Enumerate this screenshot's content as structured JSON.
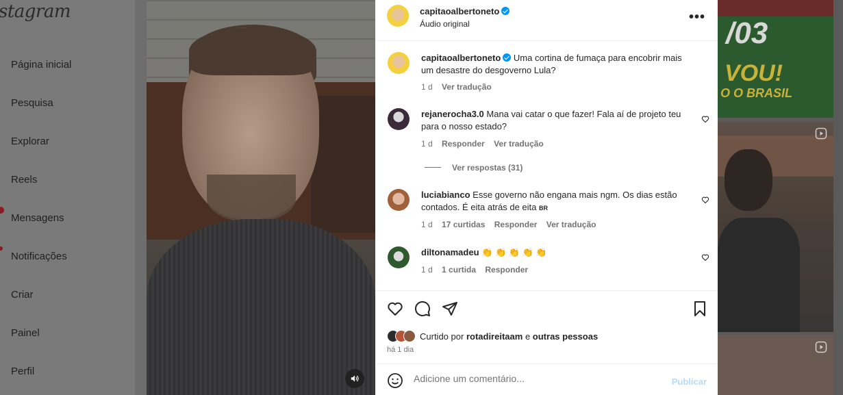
{
  "sidebar": {
    "logo": "stagram",
    "items": [
      {
        "label": "Página inicial"
      },
      {
        "label": "Pesquisa"
      },
      {
        "label": "Explorar"
      },
      {
        "label": "Reels"
      },
      {
        "label": "Mensagens"
      },
      {
        "label": "Notificações"
      },
      {
        "label": "Criar"
      },
      {
        "label": "Painel"
      },
      {
        "label": "Perfil"
      }
    ]
  },
  "background_tile": {
    "line1": "/03",
    "line2": "VOU!",
    "line3": "O O BRASIL"
  },
  "post": {
    "author": "capitaoalbertoneto",
    "audio": "Áudio original",
    "caption": {
      "author": "capitaoalbertoneto",
      "text": "Uma cortina de fumaça para encobrir mais um desastre do desgoverno Lula?",
      "time": "1 d",
      "translate": "Ver tradução"
    },
    "comments": [
      {
        "author": "rejanerocha3.0",
        "text": "Mana vai catar o que fazer! Fala aí de projeto teu para o nosso estado?",
        "time": "1 d",
        "reply": "Responder",
        "translate": "Ver tradução",
        "view_replies": "Ver respostas (31)"
      },
      {
        "author": "luciabianco",
        "text": "Esse governo não engana mais ngm. Os dias estão contados. É eita atrás de eita",
        "flag": "BR",
        "time": "1 d",
        "likes": "17 curtidas",
        "reply": "Responder",
        "translate": "Ver tradução"
      },
      {
        "author": "diltonamadeu",
        "text": "👏 👏 👏 👏 👏",
        "time": "1 d",
        "likes": "1 curtida",
        "reply": "Responder"
      }
    ],
    "liked_by_prefix": "Curtido por",
    "liked_by_user": "rotadireitaam",
    "liked_by_conj": "e",
    "liked_by_others": "outras pessoas",
    "posted_ago": "há 1 dia",
    "add_comment_placeholder": "Adicione um comentário...",
    "publish_label": "Publicar"
  },
  "colors": {
    "verified": "#0095f6",
    "publish_disabled": "#b3dbff",
    "muted_text": "#737373"
  }
}
